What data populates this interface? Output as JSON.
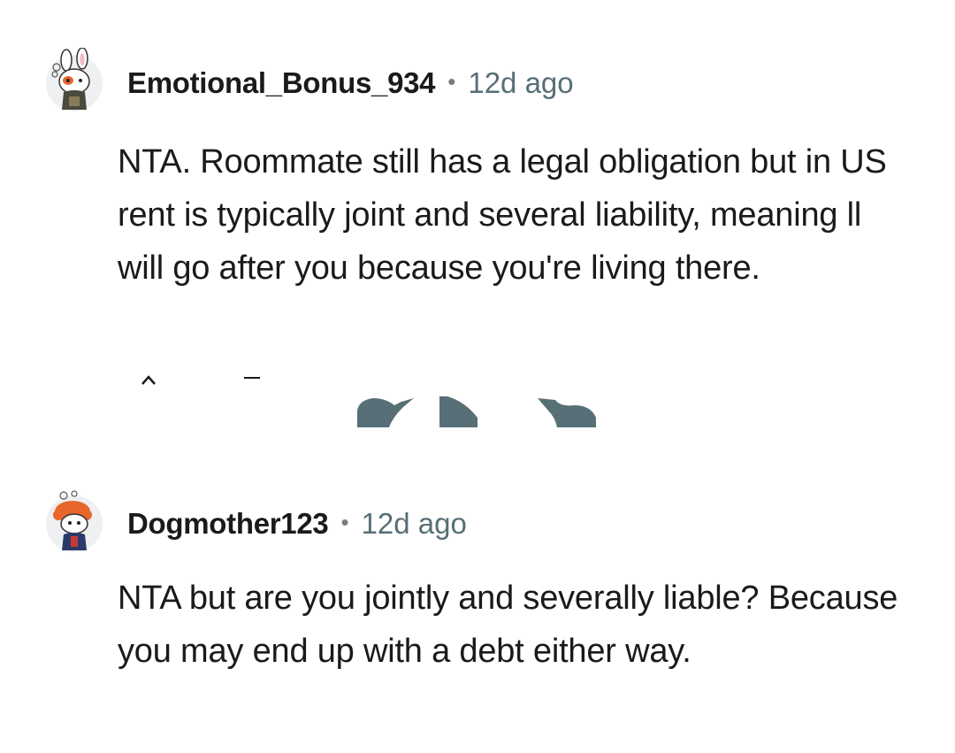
{
  "comments": [
    {
      "username": "Emotional_Bonus_934",
      "separator": "•",
      "time": "12d ago",
      "body": "NTA. Roommate still has a legal obligation but in US rent is typically joint and several liability, meaning ll will go after you because you're living there.",
      "avatar_icon": "snoo-bunny-avatar-icon",
      "actions": [
        "upvote-icon",
        "downvote-icon",
        "award-icon",
        "reply-icon",
        "share-icon"
      ],
      "action_icon_color": "#576f76"
    },
    {
      "username": "Dogmother123",
      "separator": "•",
      "time": "12d ago",
      "body": "NTA but are you jointly and severally liable? Because you may end up with a debt either way.",
      "avatar_icon": "snoo-orange-hair-avatar-icon"
    }
  ],
  "colors": {
    "text": "#1a1a1b",
    "meta": "#576f76",
    "background": "#ffffff"
  }
}
